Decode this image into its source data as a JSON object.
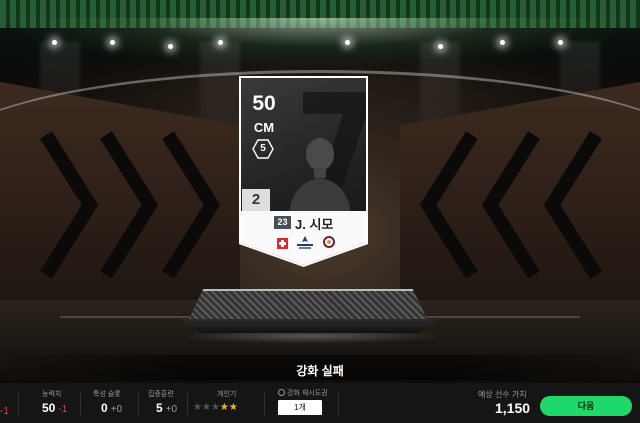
{
  "card": {
    "ovr": "50",
    "position": "CM",
    "skill_moves": "5",
    "grade": "2",
    "jersey": "23",
    "name": "J. 시모",
    "nation_flag_icon": "switzerland-flag-icon",
    "league_logo_icon": "league-logo-icon",
    "club_logo_icon": "club-crest-icon"
  },
  "result": {
    "text": "강화 실패"
  },
  "stats": [
    {
      "label": "능력치",
      "value": "50",
      "delta": "-1"
    },
    {
      "label": "특성 슬롯",
      "value": "0",
      "delta": "+0"
    },
    {
      "label": "집중훈련",
      "value": "5",
      "delta": "+0"
    }
  ],
  "edge_stat": {
    "label": "",
    "delta": "-1"
  },
  "popularity": {
    "label": "개인기",
    "stars_total": 5,
    "stars_on": 2
  },
  "retry": {
    "label": "강화 재시도권",
    "button": "1개"
  },
  "price": {
    "label": "예상 선수 가치",
    "value": "1,150"
  },
  "next_button": "다음",
  "colors": {
    "accent": "#1fd86a",
    "negative": "#e0463c",
    "star": "#f0b429"
  }
}
